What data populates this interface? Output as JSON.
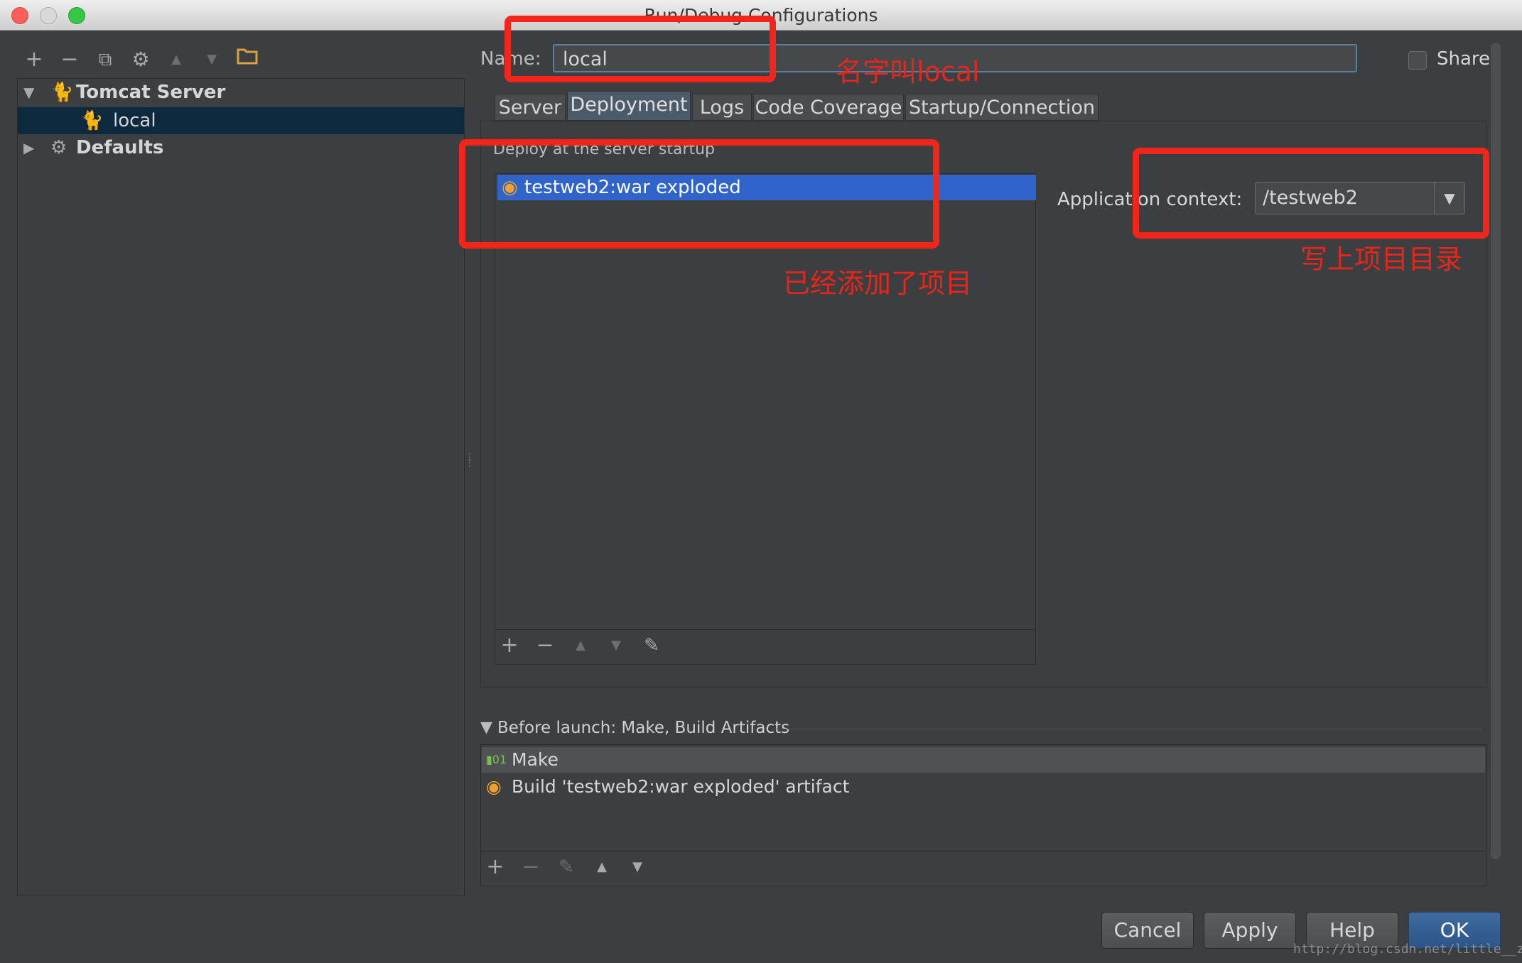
{
  "window": {
    "title": "Run/Debug Configurations"
  },
  "toolbar": {
    "add": "+",
    "remove": "−",
    "copy": "⧉",
    "edit_defaults": "⚙",
    "move_up": "▲",
    "move_down": "▼",
    "folder": "▬"
  },
  "tree": {
    "groups": [
      {
        "label": "Tomcat Server",
        "icon": "tomcat-icon",
        "expanded": true
      },
      {
        "label": "Defaults",
        "icon": "wrench-icon",
        "expanded": false
      }
    ],
    "items": [
      {
        "label": "local",
        "icon": "tomcat-icon",
        "selected": true
      }
    ]
  },
  "form": {
    "name_label": "Name:",
    "name_value": "local",
    "share_label": "Share",
    "share_checked": false
  },
  "tabs": [
    {
      "label": "Server",
      "active": false
    },
    {
      "label": "Deployment",
      "active": true
    },
    {
      "label": "Logs",
      "active": false
    },
    {
      "label": "Code Coverage",
      "active": false
    },
    {
      "label": "Startup/Connection",
      "active": false
    }
  ],
  "deployment": {
    "section_label": "Deploy at the server startup",
    "items": [
      {
        "label": "testweb2:war exploded",
        "icon": "artifact-icon",
        "selected": true
      }
    ],
    "tools": {
      "add": "+",
      "remove": "−",
      "up": "▲",
      "down": "▼",
      "edit": "✎"
    },
    "context_label": "Application context:",
    "context_value": "/testweb2"
  },
  "before_launch": {
    "label": "Before launch: Make, Build Artifacts",
    "items": [
      {
        "label": "Make",
        "icon": "make-icon"
      },
      {
        "label": "Build 'testweb2:war exploded' artifact",
        "icon": "artifact-icon"
      }
    ],
    "tools": {
      "add": "+",
      "remove": "−",
      "edit": "✎",
      "up": "▲",
      "down": "▼"
    }
  },
  "buttons": {
    "cancel": "Cancel",
    "apply": "Apply",
    "help": "Help",
    "ok": "OK"
  },
  "annotations": {
    "name_note": "名字叫local",
    "deploy_note": "已经添加了项目",
    "context_note": "写上项目目录",
    "color": "#f2251b"
  },
  "watermark": "http://blog.csdn.net/little__zm"
}
